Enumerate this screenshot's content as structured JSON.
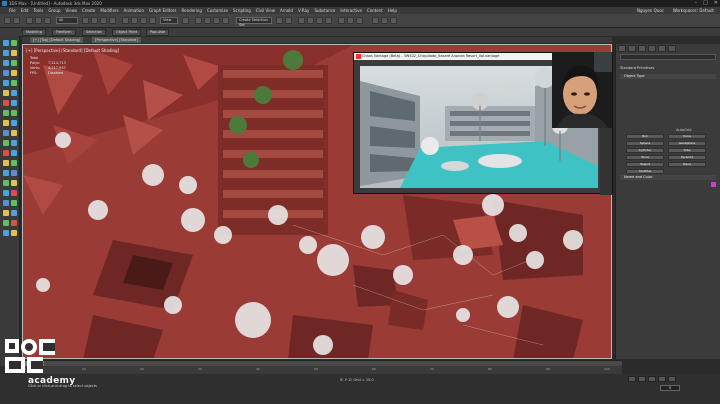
{
  "app": {
    "title": "3DS Max - [Untitled] - Autodesk 3ds Max 2020",
    "window_controls": [
      "–",
      "□",
      "✕"
    ]
  },
  "menu": {
    "items": [
      "File",
      "Edit",
      "Tools",
      "Group",
      "Views",
      "Create",
      "Modifiers",
      "Animation",
      "Graph Editors",
      "Rendering",
      "Customize",
      "Scripting",
      "Civil View",
      "Arnold",
      "V-Ray",
      "Substance",
      "Interactive",
      "Content",
      "Help"
    ],
    "user": "Nguyen Quoc",
    "workspaces": "Workspaces: Default"
  },
  "toolbar": {
    "selection_filter": "All",
    "view_dropdown": "View",
    "selection_set": "Create Selection Set"
  },
  "ribbon": {
    "tabs": [
      "Modeling",
      "Freeform",
      "Selection",
      "Object Paint",
      "Populate"
    ]
  },
  "viewport_tabs": [
    "[+] [Top] [Default Shading]",
    "[Perspective] [Standard]"
  ],
  "viewport": {
    "label": "[+] [Perspective] [Standard] [Default Shading]",
    "stats": [
      {
        "k": "Total",
        "v": ""
      },
      {
        "k": "Polys:",
        "v": "7,214,713"
      },
      {
        "k": "Verts:",
        "v": "4,217,937"
      },
      {
        "k": "FPS:",
        "v": "Disabled"
      }
    ]
  },
  "frame_buffer": {
    "title": "Chaos Vantage (Beta) - 3WS02_Chiquilado_Itacaré Ananda Resort_Vol.vantage"
  },
  "command_panel": {
    "dropdown": "Standard Primitives",
    "subtitle": "Standard Primitives",
    "object_type": "Object Type",
    "autogrid": "AutoGrid",
    "buttons": [
      "Box",
      "Cone",
      "Sphere",
      "GeoSphere",
      "Cylinder",
      "Tube",
      "Torus",
      "Pyramid",
      "Teapot",
      "Plane",
      "TextPlus"
    ],
    "name_color": "Name and Color"
  },
  "timeline": {
    "slider": "0 / 100",
    "ticks": [
      "0",
      "10",
      "20",
      "30",
      "40",
      "50",
      "60",
      "70",
      "80",
      "90",
      "100"
    ]
  },
  "status": {
    "message": "Click or click-and-drag to select objects",
    "coords": "X:   Y:   Z:   Grid = 10.0",
    "frame": "0"
  },
  "brand": {
    "logo_text": "academy",
    "logo_color": "#ffffff",
    "accent": "#d43ad0",
    "viewport_color": "#9e3a35"
  }
}
